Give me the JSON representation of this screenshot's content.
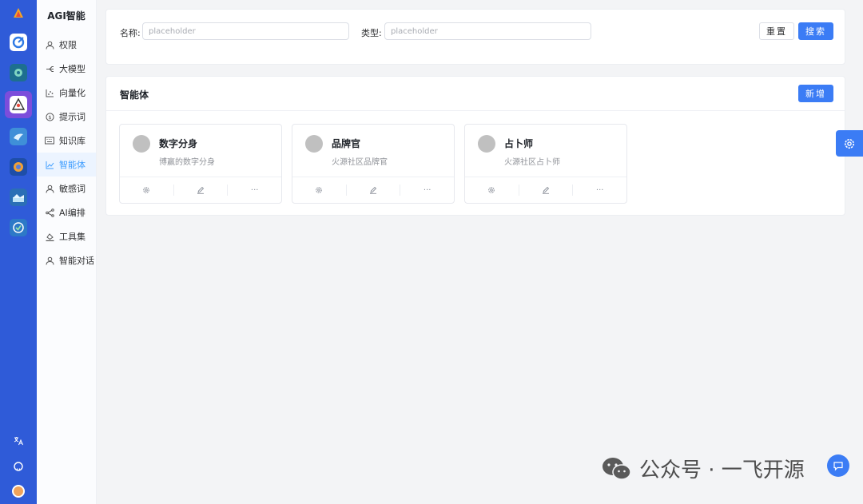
{
  "sidebar": {
    "title": "AGI智能",
    "items": [
      {
        "label": "权限",
        "icon": "user-icon"
      },
      {
        "label": "大模型",
        "icon": "branch-icon"
      },
      {
        "label": "向量化",
        "icon": "scatter-chart-icon"
      },
      {
        "label": "提示词",
        "icon": "dollar-circle-icon"
      },
      {
        "label": "知识库",
        "icon": "keyboard-icon"
      },
      {
        "label": "智能体",
        "icon": "line-chart-icon",
        "active": true
      },
      {
        "label": "敏感词",
        "icon": "user-icon"
      },
      {
        "label": "AI编排",
        "icon": "share-icon"
      },
      {
        "label": "工具集",
        "icon": "paint-bucket-icon"
      },
      {
        "label": "智能对话",
        "icon": "user-icon"
      }
    ]
  },
  "search": {
    "name_label": "名称:",
    "name_placeholder": "placeholder",
    "type_label": "类型:",
    "type_placeholder": "placeholder",
    "reset_label": "重置",
    "search_label": "搜索"
  },
  "agents": {
    "title": "智能体",
    "add_label": "新增",
    "items": [
      {
        "name": "数字分身",
        "desc": "博赢的数字分身"
      },
      {
        "name": "品牌官",
        "desc": "火源社区品牌官"
      },
      {
        "name": "占卜师",
        "desc": "火源社区占卜师"
      }
    ],
    "more_label": "···"
  },
  "watermark": {
    "text": "公众号 · 一飞开源"
  },
  "colors": {
    "rail": "#2f5bd8",
    "primary": "#3b7cf5",
    "active_app": "#7c4ddb"
  }
}
